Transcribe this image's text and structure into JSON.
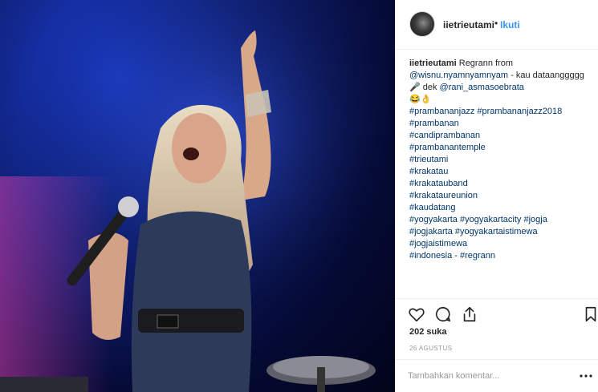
{
  "post": {
    "username": "iietrieutami",
    "separator": "•",
    "follow_label": "Ikuti"
  },
  "caption": {
    "username": "iietrieutami",
    "text_1": " Regrann from ",
    "mention_1": "@wisnu.nyamnyamnyam",
    "text_2": " - kau dataanggggg 🎤 dek ",
    "mention_2": "@rani_asmasoebrata",
    "emoji_line": "😂👌",
    "hashtags": [
      "#prambananjazz #prambananjazz2018",
      "#prambanan",
      "#candiprambanan",
      "#prambanantemple",
      "#trieutami",
      "#krakatau",
      "#krakatauband",
      "#krakataureunion",
      "#kaudatang",
      "#yogyakarta #yogyakartacity #jogja",
      "#jogjakarta #yogyakartaistimewa",
      "#jogjaistimewa"
    ],
    "last_line_tag": "#indonesia",
    "last_line_sep": " - ",
    "last_line_tag_2": "#regrann"
  },
  "actions": {
    "like_icon": "heart-icon",
    "comment_icon": "comment-icon",
    "share_icon": "share-icon",
    "save_icon": "bookmark-icon"
  },
  "likes_label": "202 suka",
  "date_label": "26 AGUSTUS",
  "comment": {
    "placeholder": "Tambahkan komentar...",
    "more_icon": "more-icon"
  },
  "colors": {
    "link": "#003569",
    "follow": "#3897f0",
    "border": "#efefef"
  }
}
